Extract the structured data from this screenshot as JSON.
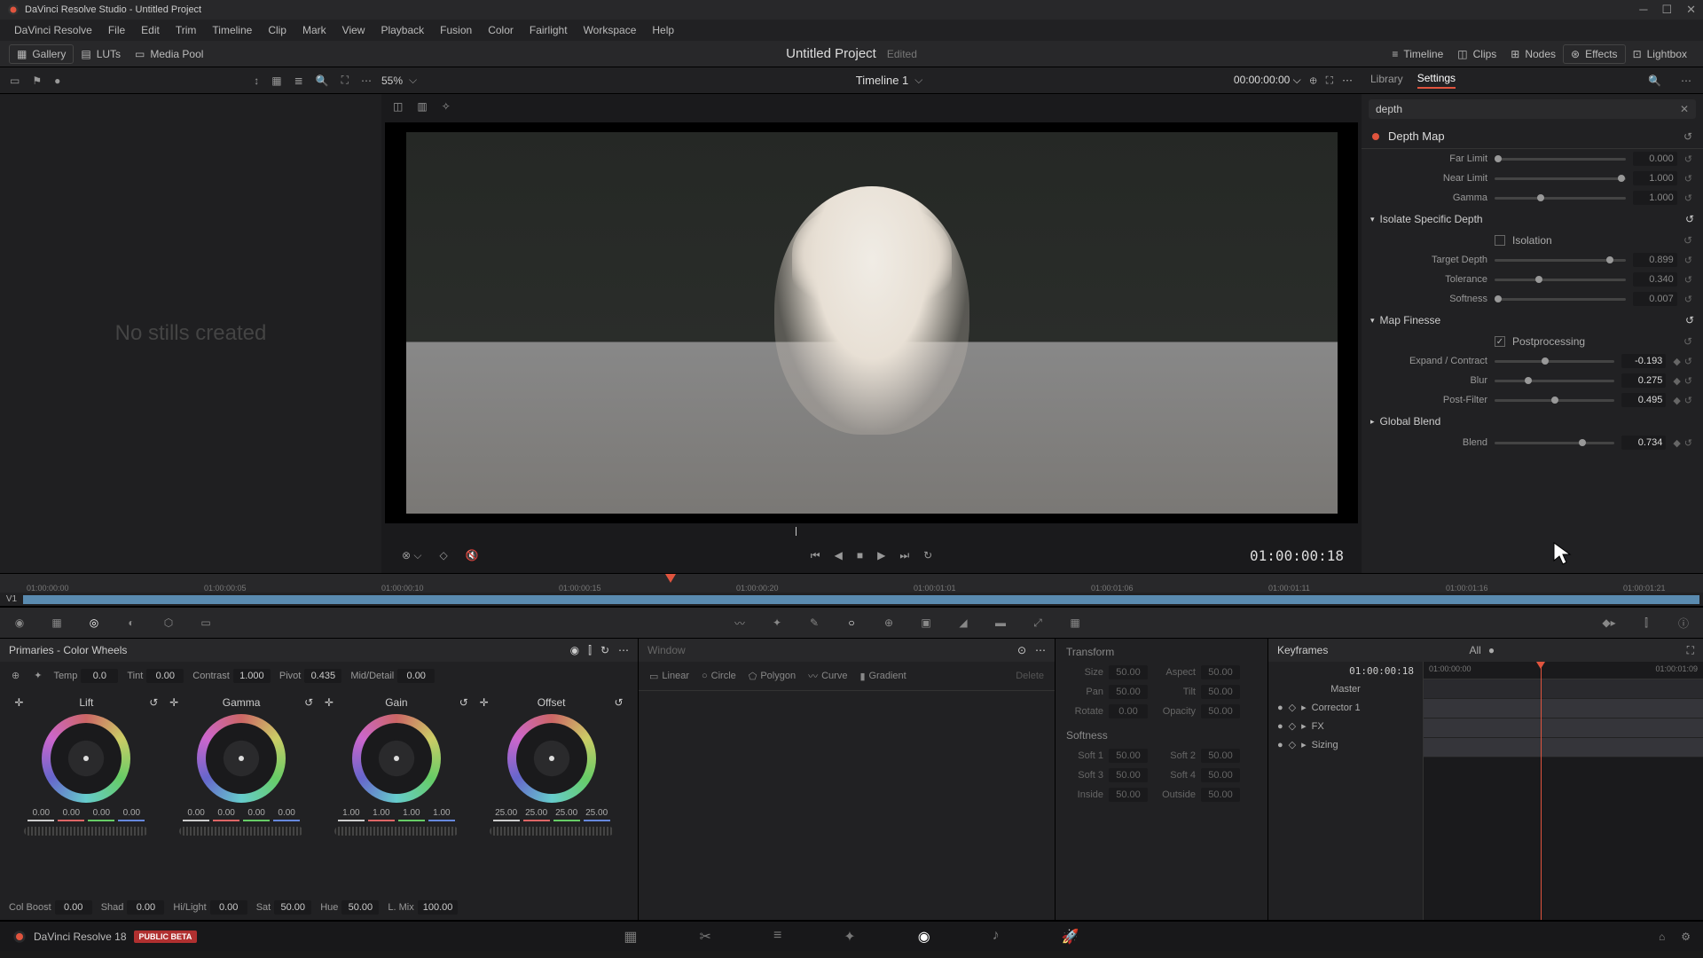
{
  "window": {
    "title": "DaVinci Resolve Studio - Untitled Project"
  },
  "menubar": [
    "DaVinci Resolve",
    "File",
    "Edit",
    "Trim",
    "Timeline",
    "Clip",
    "Mark",
    "View",
    "Playback",
    "Fusion",
    "Color",
    "Fairlight",
    "Workspace",
    "Help"
  ],
  "top_toolbar": {
    "gallery": "Gallery",
    "luts": "LUTs",
    "media_pool": "Media Pool",
    "timeline": "Timeline",
    "clips": "Clips",
    "nodes": "Nodes",
    "effects": "Effects",
    "lightbox": "Lightbox"
  },
  "project": {
    "name": "Untitled Project",
    "status": "Edited"
  },
  "sub": {
    "zoom": "55%",
    "timeline_name": "Timeline 1",
    "timecode": "00:00:00:00",
    "tabs": [
      "Library",
      "Settings"
    ]
  },
  "gallery_empty": "No stills created",
  "viewer": {
    "timecode": "01:00:00:18"
  },
  "search": {
    "value": "depth"
  },
  "effect": {
    "name": "Depth Map",
    "params1": [
      {
        "label": "Far Limit",
        "value": "0.000",
        "handle": 3,
        "dim": true
      },
      {
        "label": "Near Limit",
        "value": "1.000",
        "handle": 97,
        "dim": true
      },
      {
        "label": "Gamma",
        "value": "1.000",
        "handle": 35,
        "dim": true
      }
    ],
    "isolate": {
      "header": "Isolate Specific Depth",
      "isolation_label": "Isolation",
      "params": [
        {
          "label": "Target Depth",
          "value": "0.899",
          "handle": 88,
          "dim": true
        },
        {
          "label": "Tolerance",
          "value": "0.340",
          "handle": 34,
          "dim": true
        },
        {
          "label": "Softness",
          "value": "0.007",
          "handle": 3,
          "dim": true
        }
      ]
    },
    "finesse": {
      "header": "Map Finesse",
      "post_label": "Postprocessing",
      "params": [
        {
          "label": "Expand / Contract",
          "value": "-0.193",
          "handle": 42
        },
        {
          "label": "Blur",
          "value": "0.275",
          "handle": 28
        },
        {
          "label": "Post-Filter",
          "value": "0.495",
          "handle": 50
        }
      ]
    },
    "global": {
      "header": "Global Blend",
      "blend": {
        "label": "Blend",
        "value": "0.734",
        "handle": 73
      }
    }
  },
  "ruler": [
    "01:00:00:00",
    "01:00:00:05",
    "01:00:00:10",
    "01:00:00:15",
    "01:00:00:20",
    "01:00:01:01",
    "01:00:01:06",
    "01:00:01:11",
    "01:00:01:16",
    "01:00:01:21"
  ],
  "track": "V1",
  "primaries": {
    "title": "Primaries - Color Wheels",
    "adjustments": [
      {
        "label": "Temp",
        "value": "0.0"
      },
      {
        "label": "Tint",
        "value": "0.00"
      },
      {
        "label": "Contrast",
        "value": "1.000"
      },
      {
        "label": "Pivot",
        "value": "0.435"
      },
      {
        "label": "Mid/Detail",
        "value": "0.00"
      }
    ],
    "wheels": [
      {
        "name": "Lift",
        "nums": [
          "0.00",
          "0.00",
          "0.00",
          "0.00"
        ]
      },
      {
        "name": "Gamma",
        "nums": [
          "0.00",
          "0.00",
          "0.00",
          "0.00"
        ]
      },
      {
        "name": "Gain",
        "nums": [
          "1.00",
          "1.00",
          "1.00",
          "1.00"
        ]
      },
      {
        "name": "Offset",
        "nums": [
          "25.00",
          "25.00",
          "25.00",
          "25.00"
        ]
      }
    ],
    "bottom": [
      {
        "label": "Col Boost",
        "value": "0.00"
      },
      {
        "label": "Shad",
        "value": "0.00"
      },
      {
        "label": "Hi/Light",
        "value": "0.00"
      },
      {
        "label": "Sat",
        "value": "50.00"
      },
      {
        "label": "Hue",
        "value": "50.00"
      },
      {
        "label": "L. Mix",
        "value": "100.00"
      }
    ]
  },
  "window_panel": {
    "title": "Window",
    "shapes": [
      "Linear",
      "Circle",
      "Polygon",
      "Curve",
      "Gradient"
    ],
    "delete": "Delete"
  },
  "sizing": {
    "transform": "Transform",
    "rows": [
      [
        {
          "label": "Size",
          "value": "50.00"
        },
        {
          "label": "Aspect",
          "value": "50.00"
        }
      ],
      [
        {
          "label": "Pan",
          "value": "50.00"
        },
        {
          "label": "Tilt",
          "value": "50.00"
        }
      ],
      [
        {
          "label": "Rotate",
          "value": "0.00"
        },
        {
          "label": "Opacity",
          "value": "50.00"
        }
      ]
    ],
    "softness": "Softness",
    "soft_rows": [
      [
        {
          "label": "Soft 1",
          "value": "50.00"
        },
        {
          "label": "Soft 2",
          "value": "50.00"
        }
      ],
      [
        {
          "label": "Soft 3",
          "value": "50.00"
        },
        {
          "label": "Soft 4",
          "value": "50.00"
        }
      ],
      [
        {
          "label": "Inside",
          "value": "50.00"
        },
        {
          "label": "Outside",
          "value": "50.00"
        }
      ]
    ]
  },
  "keyframes": {
    "title": "Keyframes",
    "all": "All",
    "tc": "01:00:00:18",
    "ruler": [
      "01:00:00:00",
      "01:00:01:09"
    ],
    "tracks": [
      "Master",
      "Corrector 1",
      "FX",
      "Sizing"
    ]
  },
  "app": {
    "name": "DaVinci Resolve 18",
    "beta": "PUBLIC BETA"
  }
}
